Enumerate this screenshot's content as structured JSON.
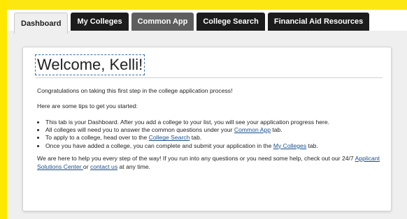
{
  "tabs": [
    {
      "label": "Dashboard",
      "active": true
    },
    {
      "label": "My Colleges"
    },
    {
      "label": "Common App"
    },
    {
      "label": "College Search"
    },
    {
      "label": "Financial Aid Resources"
    }
  ],
  "main": {
    "title": "Welcome, Kelli!",
    "intro": "Congratulations on taking this first step in the college application process!",
    "tips_intro": "Here are some tips to get you started:",
    "tips": [
      {
        "text": "This tab is your Dashboard. After you add a college to your list, you will see your application progress here."
      },
      {
        "before": "All colleges will need you to answer the common questions under your ",
        "link": "Common App",
        "after": " tab."
      },
      {
        "before": "To apply to a college, head over to the ",
        "link": "College Search",
        "after": " tab."
      },
      {
        "before": "Once you have added a college, you can complete and submit your application in the ",
        "link": "My Colleges",
        "after": " tab."
      }
    ],
    "help": {
      "before": "We are here to help you every step of the way! If you run into any questions or you need some help, check out our 24/7 ",
      "link1": "Applicant Solutions Center ",
      "middle": "or ",
      "link2": "contact us",
      "after": " at any time."
    }
  }
}
